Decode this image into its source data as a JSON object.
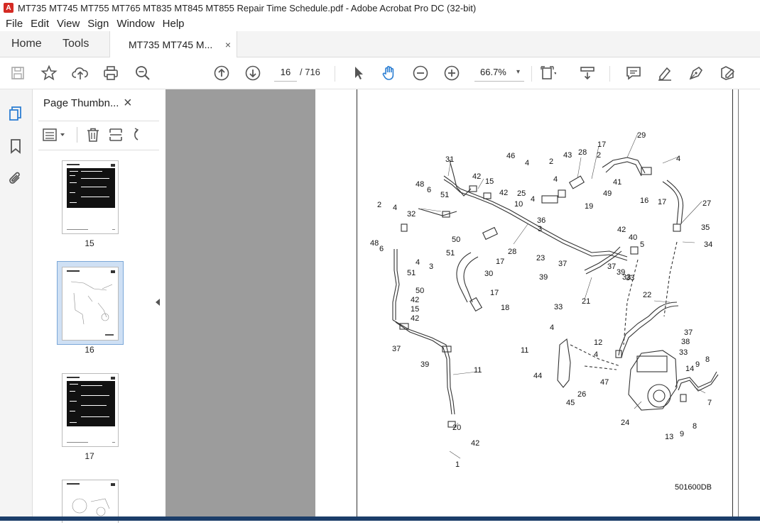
{
  "window": {
    "title": "MT735  MT745  MT755  MT765  MT835  MT845  MT855 Repair Time Schedule.pdf - Adobe Acrobat Pro DC (32-bit)",
    "app_icon": "acrobat-icon"
  },
  "menu": {
    "items": [
      "File",
      "Edit",
      "View",
      "Sign",
      "Window",
      "Help"
    ]
  },
  "tabs": {
    "home": "Home",
    "tools": "Tools",
    "document": "MT735  MT745  M...",
    "close": "×"
  },
  "toolbar": {
    "current_page": "16",
    "total_pages": "/ 716",
    "zoom": "66.7%",
    "zoom_dropdown": "▾"
  },
  "thumbnails": {
    "title": "Page Thumbn...",
    "close": "×",
    "pages": [
      {
        "label": "15"
      },
      {
        "label": "16",
        "selected": true
      },
      {
        "label": "17"
      }
    ]
  },
  "drawing": {
    "code": "501600DB",
    "callouts": [
      "29",
      "17",
      "46",
      "4",
      "2",
      "43",
      "28",
      "2",
      "4",
      "31",
      "42",
      "15",
      "4",
      "41",
      "49",
      "16",
      "17",
      "27",
      "48",
      "6",
      "51",
      "42",
      "25",
      "19",
      "4",
      "36",
      "2",
      "4",
      "32",
      "10",
      "50",
      "3",
      "35",
      "34",
      "48",
      "6",
      "51",
      "4",
      "3",
      "28",
      "17",
      "42",
      "40",
      "5",
      "23",
      "37",
      "37",
      "39",
      "39",
      "33",
      "51",
      "30",
      "33",
      "21",
      "50",
      "17",
      "18",
      "22",
      "42",
      "15",
      "42",
      "33",
      "37",
      "38",
      "33",
      "4",
      "11",
      "12",
      "4",
      "37",
      "39",
      "11",
      "44",
      "26",
      "45",
      "47",
      "14",
      "9",
      "8",
      "7",
      "24",
      "20",
      "42",
      "1",
      "13",
      "9",
      "8",
      "7"
    ]
  }
}
